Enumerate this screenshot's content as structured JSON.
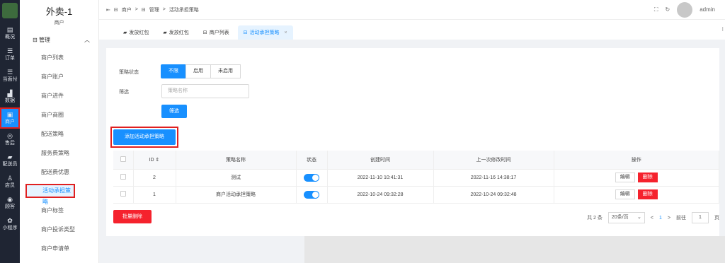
{
  "rail": [
    {
      "icon": "dashboard-icon",
      "glyph": "▤",
      "label": "概况",
      "active": false
    },
    {
      "icon": "list-icon",
      "glyph": "☰",
      "label": "订单",
      "active": false
    },
    {
      "icon": "list-icon",
      "glyph": "☰",
      "label": "当面付",
      "active": false
    },
    {
      "icon": "bar-chart-icon",
      "glyph": "▟",
      "label": "数据",
      "active": false
    },
    {
      "icon": "store-icon",
      "glyph": "▣",
      "label": "商户",
      "active": true
    },
    {
      "icon": "headset-icon",
      "glyph": "◎",
      "label": "售后",
      "active": false
    },
    {
      "icon": "courier-icon",
      "glyph": "▰",
      "label": "配送员",
      "active": false
    },
    {
      "icon": "clerk-icon",
      "glyph": "♙",
      "label": "店员",
      "active": false
    },
    {
      "icon": "customer-icon",
      "glyph": "◉",
      "label": "顾客",
      "active": false
    },
    {
      "icon": "miniprogram-icon",
      "glyph": "✿",
      "label": "小程序",
      "active": false
    }
  ],
  "brand": {
    "title": "外卖-1",
    "subtitle": "商户"
  },
  "subnav": {
    "group_label": "管理",
    "items": [
      "商户列表",
      "商户账户",
      "商户进件",
      "商户商圈",
      "配送策略",
      "服务费策略",
      "配送费优惠",
      "活动承担策略",
      "商户标签",
      "商户投诉类型",
      "商户申请单"
    ],
    "active_index": 7
  },
  "breadcrumb": {
    "items": [
      "商户",
      "管理",
      "活动承担策略"
    ]
  },
  "user": {
    "name": "admin"
  },
  "tabs": [
    {
      "label": "发放红包",
      "icon": "wallet-icon",
      "active": false
    },
    {
      "label": "发放红包",
      "icon": "wallet-icon",
      "active": false
    },
    {
      "label": "商户列表",
      "icon": "store-icon",
      "active": false
    },
    {
      "label": "活动承担策略",
      "icon": "store-icon",
      "active": true
    }
  ],
  "filters": {
    "status_label": "策略状态",
    "status_options": [
      "不限",
      "启用",
      "未启用"
    ],
    "status_selected": 0,
    "search_label": "筛选",
    "search_placeholder": "策略名称",
    "search_button": "筛选"
  },
  "add_button": "添加活动承担策略",
  "table": {
    "headers": [
      "ID",
      "策略名称",
      "状态",
      "创建时间",
      "上一次修改时间",
      "操作"
    ],
    "rows": [
      {
        "id": "2",
        "name": "测试",
        "enabled": true,
        "created": "2022-11-10 10:41:31",
        "updated": "2022-11-16 14:38:17"
      },
      {
        "id": "1",
        "name": "商户活动承担策略",
        "enabled": true,
        "created": "2022-10-24 09:32:28",
        "updated": "2022-10-24 09:32:48"
      }
    ],
    "edit_label": "编辑",
    "delete_label": "删除"
  },
  "bulk_delete": "批量删除",
  "pagination": {
    "total": "共 2 条",
    "page_size": "20条/页",
    "current": "1",
    "goto_label": "前往",
    "goto_value": "1",
    "page_unit": "页"
  },
  "colors": {
    "primary": "#1890ff",
    "danger": "#f5222d",
    "highlight": "#e02020",
    "rail_bg": "#1f2533"
  }
}
